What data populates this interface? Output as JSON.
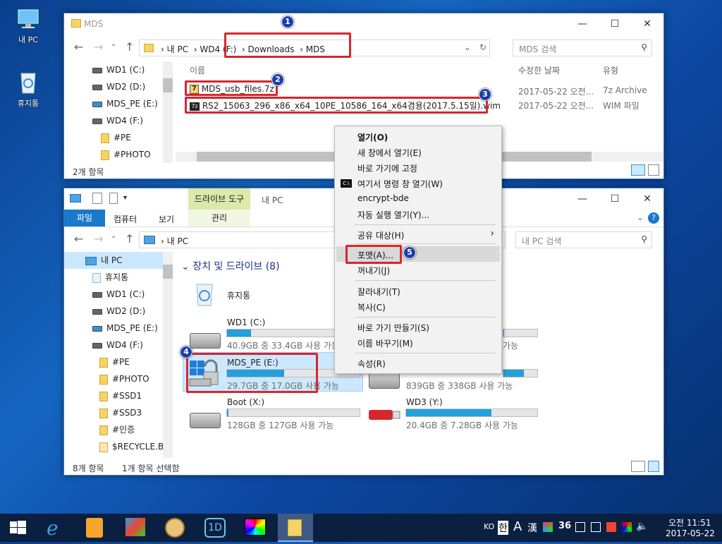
{
  "desktop": {
    "icons": [
      "내 PC",
      "휴지통"
    ]
  },
  "win1": {
    "title": "MDS",
    "breadcrumb": [
      "내 PC",
      "WD4 (F:)",
      "Downloads",
      "MDS"
    ],
    "search_placeholder": "MDS 검색",
    "tree": [
      "WD1 (C:)",
      "WD2 (D:)",
      "MDS_PE (E:)",
      "WD4 (F:)",
      "#PE",
      "#PHOTO"
    ],
    "columns": {
      "name": "이름",
      "date": "수정한 날짜",
      "type": "유형"
    },
    "files": [
      {
        "name": "MDS_usb_files.7z",
        "date": "2017-05-22 오전...",
        "type": "7z Archive"
      },
      {
        "name": "RS2_15063_296_x86_x64_10PE_10586_164_x64겸용(2017.5.15일).wim",
        "date": "2017-05-22 오전...",
        "type": "WIM 파일"
      }
    ],
    "status": "2개 항목"
  },
  "win2": {
    "title": "내 PC",
    "ribbon_context": "드라이브 도구",
    "tabs": [
      "파일",
      "컴퓨터",
      "보기",
      "관리"
    ],
    "breadcrumb": [
      "내 PC"
    ],
    "search_placeholder": "내 PC 검색",
    "tree": [
      "내 PC",
      "휴지통",
      "WD1 (C:)",
      "WD2 (D:)",
      "MDS_PE (E:)",
      "WD4 (F:)",
      "#PE",
      "#PHOTO",
      "#SSD1",
      "#SSD3",
      "#인증",
      "$RECYCLE.BI"
    ],
    "group_title": "장치 및 드라이브 (8)",
    "recycle_label": "휴지통",
    "drives": [
      {
        "name": "WD1 (C:)",
        "sub": "40.9GB 중 33.4GB 사용 가능",
        "fill": 0.18
      },
      {
        "name": "MDS_PE (E:)",
        "sub": "29.7GB 중 17.0GB 사용 가능",
        "fill": 0.43
      },
      {
        "name": "Boot (X:)",
        "sub": "128GB 중 127GB 사용 가능",
        "fill": 0.01
      },
      {
        "name": "",
        "sub": "839GB 중 338GB 사용 가능",
        "fill": 0.6
      },
      {
        "name": "WD3 (Y:)",
        "sub": "20.4GB 중 7.28GB 사용 가능",
        "fill": 0.65
      },
      {
        "name": "",
        "sub": "가능",
        "fill": 0.02
      }
    ],
    "status": [
      "8개 항목",
      "1개 항목 선택함"
    ]
  },
  "context_menu": [
    "열기(O)",
    "새 창에서 열기(E)",
    "바로 가기에 고정",
    "여기서 명령 창 열기(W)",
    "encrypt-bde",
    "자동 실행 열기(Y)...",
    "공유 대상(H)",
    "포맷(A)...",
    "꺼내기(J)",
    "잘라내기(T)",
    "복사(C)",
    "바로 가기 만들기(S)",
    "이름 바꾸기(M)",
    "속성(R)"
  ],
  "markers": [
    "1",
    "2",
    "3",
    "4",
    "5"
  ],
  "taskbar": {
    "lang": "KO",
    "ime": "한",
    "a": "A",
    "han": "漢",
    "time": "오전 11:51",
    "date": "2017-05-22"
  }
}
